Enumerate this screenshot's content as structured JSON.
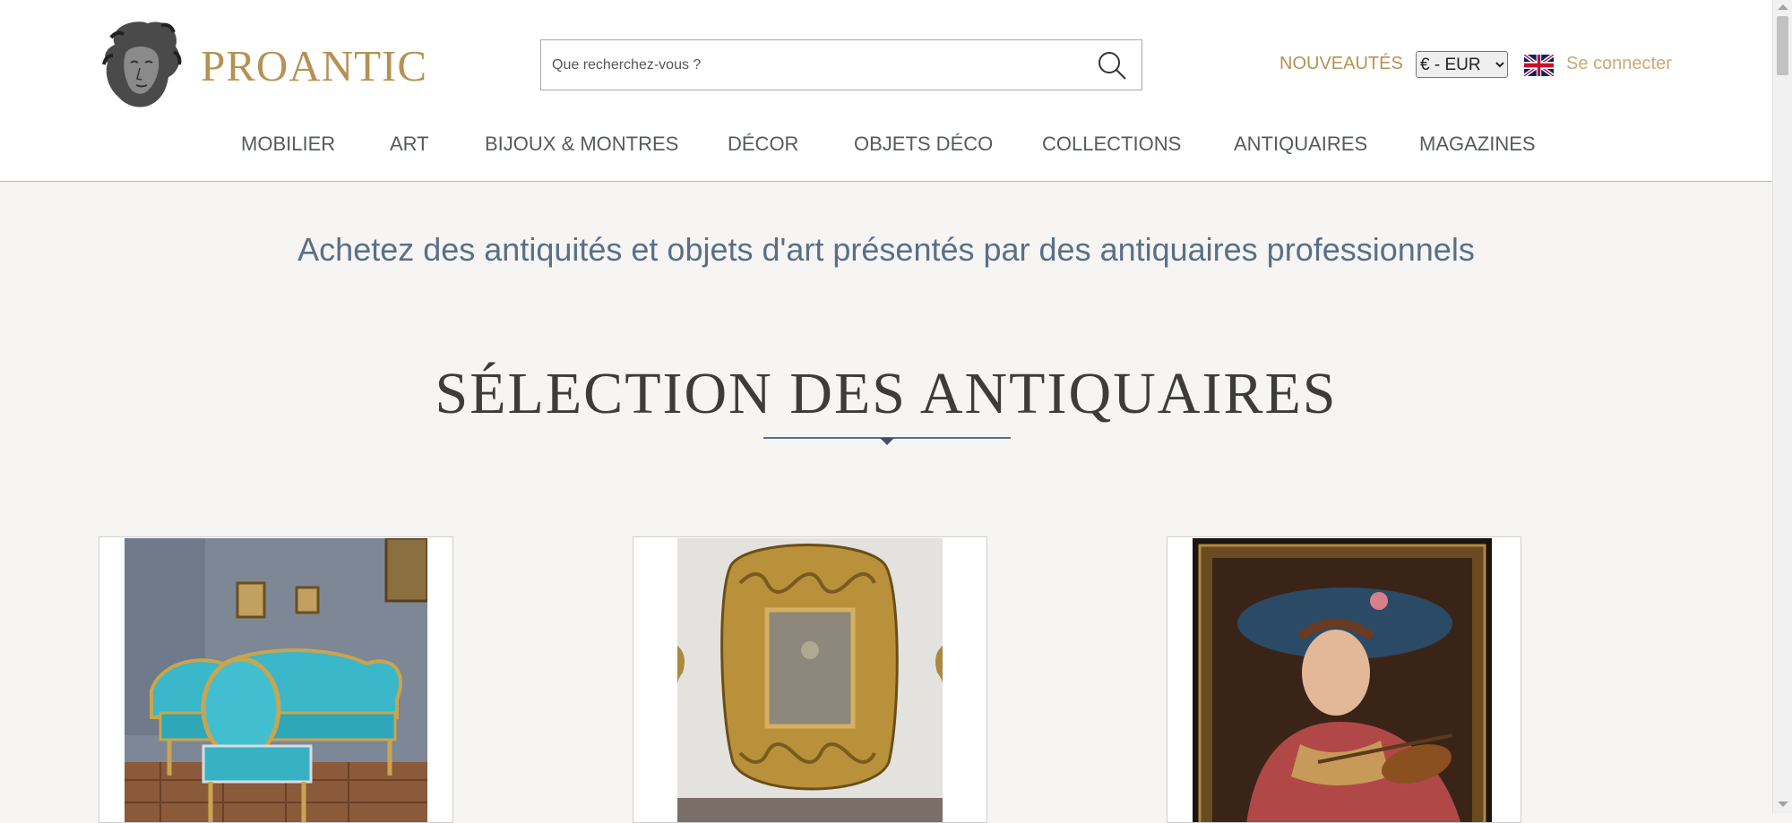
{
  "brand": {
    "name": "PROANTIC",
    "logo_icon": "classical-bust-logo",
    "accent_color": "#b69152"
  },
  "search": {
    "placeholder": "Que recherchez-vous ?",
    "value": "",
    "icon": "search-icon"
  },
  "header": {
    "news_label": "NOUVEAUTÉS",
    "currency_selected": "€ - EUR",
    "language_icon": "uk-flag-icon",
    "login_label": "Se connecter"
  },
  "nav": {
    "items": [
      {
        "label": "MOBILIER"
      },
      {
        "label": "ART"
      },
      {
        "label": "BIJOUX & MONTRES"
      },
      {
        "label": "DÉCOR"
      },
      {
        "label": "OBJETS DÉCO"
      },
      {
        "label": "COLLECTIONS"
      },
      {
        "label": "ANTIQUAIRES"
      },
      {
        "label": "MAGAZINES"
      }
    ]
  },
  "main": {
    "tagline": "Achetez des antiquités et objets d'art présentés par des antiquaires professionnels",
    "section_title": "SÉLECTION DES ANTIQUAIRES",
    "cards": [
      {
        "subject": "turquoise-gilt-salon-furniture"
      },
      {
        "subject": "carved-gilt-wood-mirror"
      },
      {
        "subject": "portrait-painting-woman-violin"
      }
    ]
  }
}
